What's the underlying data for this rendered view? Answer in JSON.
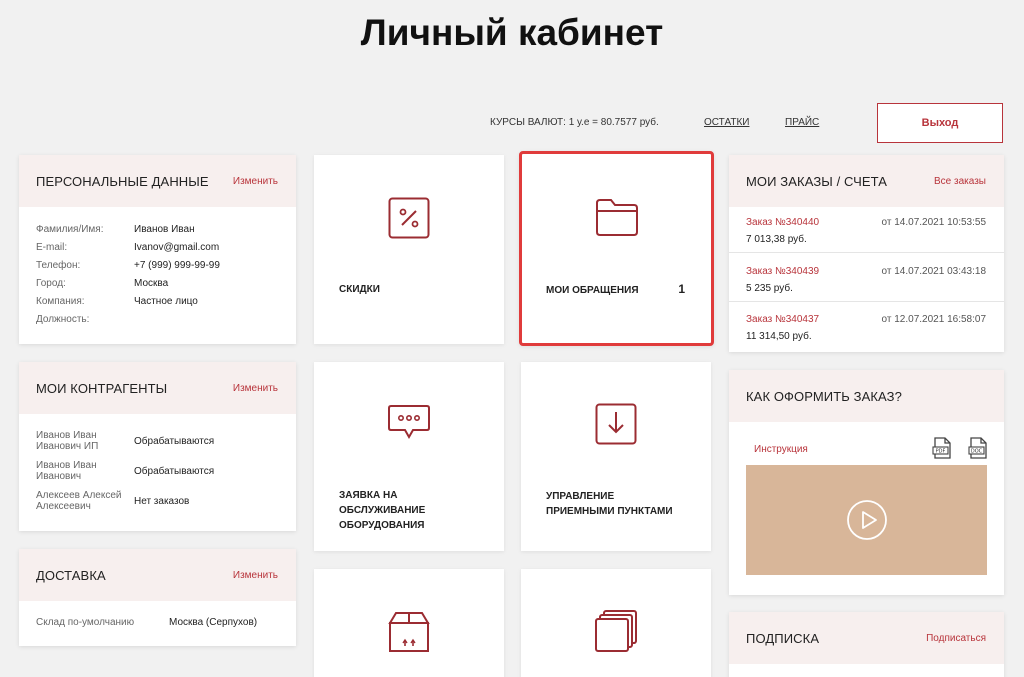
{
  "page": {
    "title": "Личный кабинет"
  },
  "topbar": {
    "rates": "КУРСЫ ВАЛЮТ: 1 у.е = 80.7577 руб.",
    "stock_link": "ОСТАТКИ",
    "price_link": "ПРАЙС",
    "logout": "Выход"
  },
  "personal": {
    "title": "ПЕРСОНАЛЬНЫЕ ДАННЫЕ",
    "action": "Изменить",
    "rows": [
      {
        "k": "Фамилия/Имя:",
        "v": "Иванов Иван"
      },
      {
        "k": "E-mail:",
        "v": "Ivanov@gmail.com"
      },
      {
        "k": "Телефон:",
        "v": "+7 (999) 999-99-99"
      },
      {
        "k": "Город:",
        "v": "Москва"
      },
      {
        "k": "Компания:",
        "v": "Частное лицо"
      },
      {
        "k": "Должность:",
        "v": ""
      }
    ]
  },
  "contractors": {
    "title": "МОИ КОНТРАГЕНТЫ",
    "action": "Изменить",
    "rows": [
      {
        "name1": "Иванов Иван",
        "name2": "Иванович ИП",
        "status": "Обрабатываются"
      },
      {
        "name1": "Иванов Иван",
        "name2": "Иванович",
        "status": "Обрабатываются"
      },
      {
        "name1": "Алексеев Алексей",
        "name2": "Алексеевич",
        "status": "Нет заказов"
      }
    ]
  },
  "delivery": {
    "title": "ДОСТАВКА",
    "action": "Изменить",
    "k": "Склад по-умолчанию",
    "v": "Москва (Серпухов)"
  },
  "tiles": {
    "discounts": "СКИДКИ",
    "requests": "МОИ ОБРАЩЕНИЯ",
    "requests_count": "1",
    "service_l1": "ЗАЯВКА НА",
    "service_l2": "ОБСЛУЖИВАНИЕ",
    "service_l3": "ОБОРУДОВАНИЯ",
    "points_l1": "УПРАВЛЕНИЕ",
    "points_l2": "ПРИЕМНЫМИ ПУНКТАМИ"
  },
  "orders": {
    "title": "МОИ ЗАКАЗЫ / СЧЕТА",
    "action": "Все заказы",
    "items": [
      {
        "num": "Заказ №340440",
        "date": "от 14.07.2021 10:53:55",
        "sum": "7 013,38 руб."
      },
      {
        "num": "Заказ №340439",
        "date": "от 14.07.2021 03:43:18",
        "sum": "5 235 руб."
      },
      {
        "num": "Заказ №340437",
        "date": "от 12.07.2021 16:58:07",
        "sum": "11 314,50 руб."
      }
    ]
  },
  "howto": {
    "title": "КАК ОФОРМИТЬ ЗАКАЗ?",
    "instruction": "Инструкция",
    "pdf_icon": "pdf-file-icon",
    "doc_icon": "doc-file-icon"
  },
  "subscription": {
    "title": "ПОДПИСКА",
    "action": "Подписаться"
  },
  "colors": {
    "accent": "#b8343b",
    "highlight": "#e03b3b",
    "video_bg": "#d8b699",
    "card_head": "#f7efee"
  }
}
